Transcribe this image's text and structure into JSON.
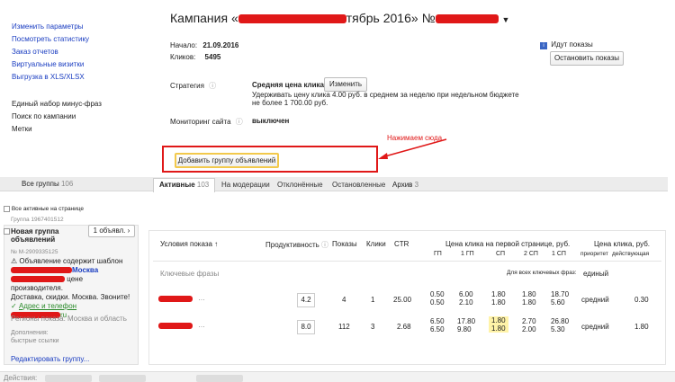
{
  "left_menu": {
    "links": [
      "Изменить параметры",
      "Посмотреть статистику",
      "Заказ отчетов",
      "Виртуальные визитки",
      "Выгрузка в XLS/XLSX"
    ],
    "plain": [
      "Единый набор минус-фраз",
      "Поиск по кампании",
      "Метки"
    ]
  },
  "campaign": {
    "title_prefix": "Кампания «",
    "title_mid": "тябрь 2016",
    "title_suffix": "» №",
    "start_label": "Начало:",
    "start_value": "21.09.2016",
    "clicks_label": "Кликов:",
    "clicks_value": "5495",
    "strategy_label": "Стратегия",
    "strategy_name": "Средняя цена клика",
    "change_button": "Изменить",
    "strategy_desc": "Удерживать цену клика 4.00 руб. в среднем за неделю при недельном бюджете не более 1 700.00 руб.",
    "monitoring_label": "Мониторинг сайта",
    "monitoring_value": "выключен"
  },
  "right_status": {
    "shows_label": "Идут показы",
    "stop_button": "Остановить показы"
  },
  "add_group_button": "Добавить группу объявлений",
  "annotation": {
    "text": "Нажимаем сюда",
    "color": "#e01818"
  },
  "tabs": {
    "all_label": "Все группы",
    "all_count": "106",
    "items": [
      {
        "label": "Активные",
        "count": "103"
      },
      {
        "label": "На модерации",
        "count": ""
      },
      {
        "label": "Отклонённые",
        "count": ""
      },
      {
        "label": "Остановленные",
        "count": ""
      },
      {
        "label": "Архив",
        "count": "3"
      }
    ]
  },
  "group": {
    "all_active_label": "Все активные на странице",
    "group_id": "Группа 1967401512",
    "name": "Новая группа объявлений",
    "ads_button": "1 объявл.",
    "ad_number": "№ M-2909335125",
    "warning": "Объявление содержит шаблон",
    "ad_title_suffix": "Москва",
    "ad_text_1": "цене производителя.",
    "ad_text_2": "Доставка, скидки. Москва. Звоните!",
    "address_link": "Адрес и телефон",
    "url_suffix": "ru",
    "regions": "Регионы показа: Москва и область",
    "extras_label": "Дополнения:",
    "extras_value": "быстрые ссылки",
    "edit_link": "Редактировать группу..."
  },
  "table": {
    "headers": {
      "conditions": "Условия показа ↑",
      "productivity": "Продуктивность",
      "shows": "Показы",
      "clicks": "Клики",
      "ctr": "CTR",
      "first_page": "Цена клика на первой странице, руб.",
      "click_price": "Цена клика, руб.",
      "sub": [
        "ГП",
        "1 ГП",
        "СП",
        "2 СП",
        "1 СП"
      ],
      "priority": "приоритет",
      "active": "действующая"
    },
    "keywords_label": "Ключевые фразы",
    "all_keywords_label": "Для всех ключевых фраз:",
    "unified_label": "единый",
    "rows": [
      {
        "productivity": "4.2",
        "shows": "4",
        "clicks": "1",
        "ctr": "25.00",
        "gp": [
          "0.50",
          "0.50"
        ],
        "gp1": [
          "6.00",
          "2.10"
        ],
        "sp": [
          "1.80",
          "1.80"
        ],
        "sp2": [
          "1.80",
          "1.80"
        ],
        "sp1": [
          "18.70",
          "5.60"
        ],
        "priority": "средний",
        "active": "0.30",
        "highlight": false
      },
      {
        "productivity": "8.0",
        "shows": "112",
        "clicks": "3",
        "ctr": "2.68",
        "gp": [
          "6.50",
          "6.50"
        ],
        "gp1": [
          "17.80",
          "9.80"
        ],
        "sp": [
          "1.80",
          "1.80"
        ],
        "sp2": [
          "2.70",
          "2.00"
        ],
        "sp1": [
          "26.80",
          "5.30"
        ],
        "priority": "средний",
        "active": "1.80",
        "highlight": true
      }
    ],
    "more": "…"
  },
  "bottom": {
    "actions_label": "Действия:"
  },
  "colors": {
    "accent_red": "#e01818",
    "link": "#1a3dc1",
    "highlight": "#fff3a8"
  }
}
